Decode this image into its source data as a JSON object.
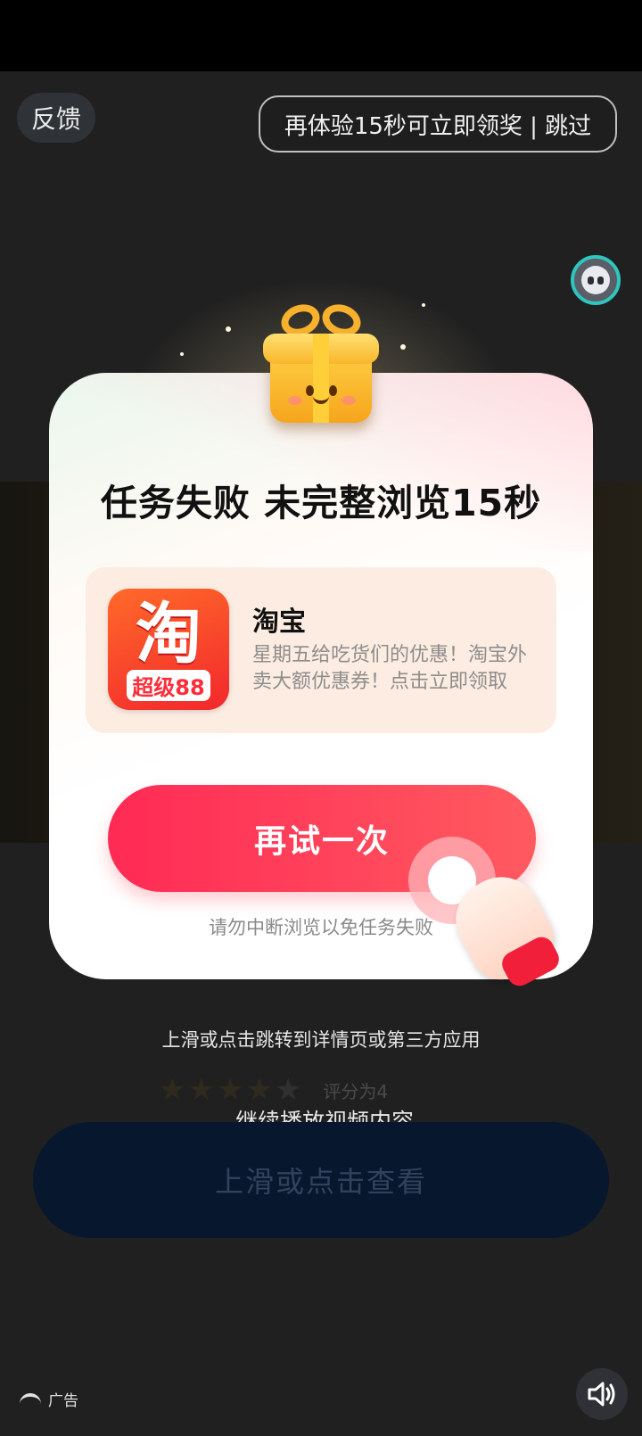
{
  "topbar": {
    "feedback_label": "反馈",
    "skip_label": "再体验15秒可立即领奖 | 跳过"
  },
  "icons": {
    "avatar": "robot-avatar-icon",
    "gift": "gift-box-icon",
    "hand": "pointing-hand-icon",
    "sound": "speaker-sound-on-icon",
    "ad": "ad-logo-icon",
    "star": "star-icon"
  },
  "modal": {
    "title": "任务失败 未完整浏览15秒",
    "app": {
      "icon_char": "淘",
      "icon_tag": "超级88",
      "name": "淘宝",
      "description": "星期五给吃货们的优惠！淘宝外卖大额优惠券！点击立即领取"
    },
    "retry_label": "再试一次",
    "hint": "请勿中断浏览以免任务失败"
  },
  "below": {
    "swipe_text": "上滑或点击跳转到详情页或第三方应用",
    "rating_value": 4,
    "rating_max": 5,
    "rating_text": "评分为4",
    "continue_link": "继续播放视频内容",
    "view_button": "上滑或点击查看"
  },
  "footer": {
    "ad_label": "广告"
  },
  "colors": {
    "accent_red": "#ff2a55",
    "teal_ring": "#2fc6c0",
    "card_bg": "#fdece1"
  }
}
